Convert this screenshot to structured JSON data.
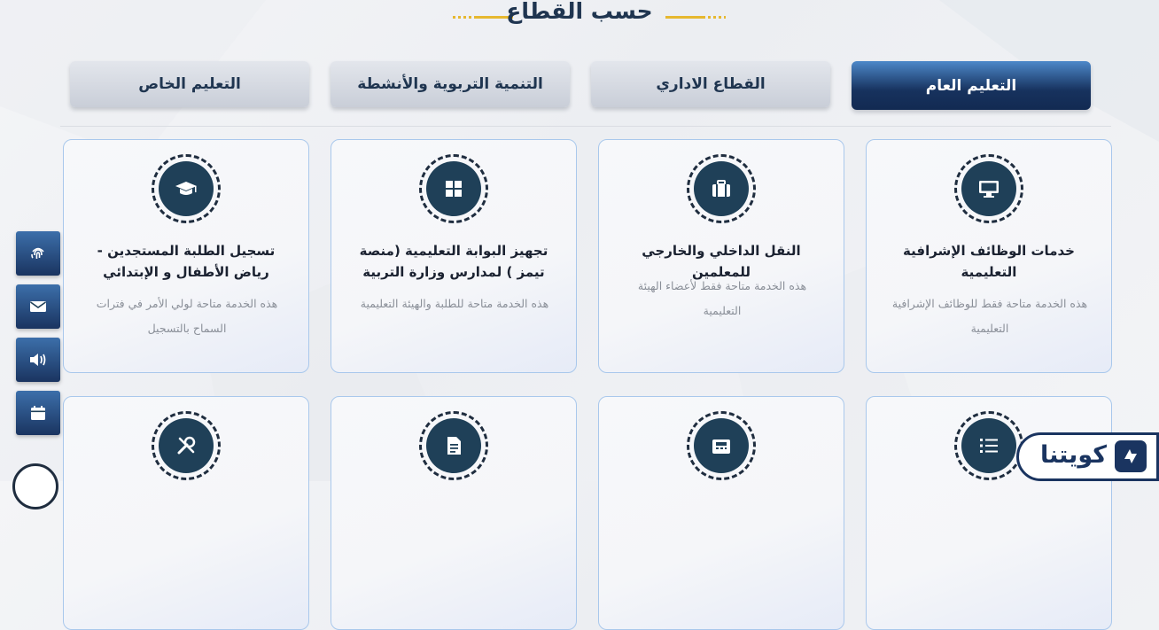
{
  "section": {
    "title": "حسب القطاع"
  },
  "tabs": [
    {
      "label": "التعليم العام",
      "active": true
    },
    {
      "label": "القطاع الاداري",
      "active": false
    },
    {
      "label": "التنمية التربوية والأنشطة",
      "active": false
    },
    {
      "label": "التعليم الخاص",
      "active": false
    }
  ],
  "cards": [
    {
      "icon": "monitor-icon",
      "title": "خدمات الوظائف الإشرافية التعليمية",
      "desc": "هذه الخدمة متاحة فقط للوظائف الإشرافية التعليمية"
    },
    {
      "icon": "briefcase-icon",
      "title": "النقل الداخلي والخارجي للمعلمين",
      "desc": "هذه الخدمة متاحة فقط لأعضاء الهيئة التعليمية"
    },
    {
      "icon": "windows-icon",
      "title": "تجهيز البوابة التعليمية (منصة تيمز ) لمدارس وزارة التربية",
      "desc": "هذه الخدمة متاحة للطلبة والهيئة التعليمية"
    },
    {
      "icon": "graduation-cap-icon",
      "title": "تسجيل الطلبة المستجدين - رياض الأطفال و الإبتدائي",
      "desc": "هذه الخدمة متاحة لولي الأمر في فترات السماح بالتسجيل"
    }
  ],
  "cards_row2": [
    {
      "icon": "list-icon"
    },
    {
      "icon": "fax-icon"
    },
    {
      "icon": "document-icon"
    },
    {
      "icon": "tools-icon"
    }
  ],
  "side_buttons": [
    {
      "icon": "fingerprint-icon"
    },
    {
      "icon": "envelope-icon"
    },
    {
      "icon": "volume-icon"
    },
    {
      "icon": "calendar-icon"
    }
  ],
  "logo": {
    "text": "كويتنا"
  }
}
